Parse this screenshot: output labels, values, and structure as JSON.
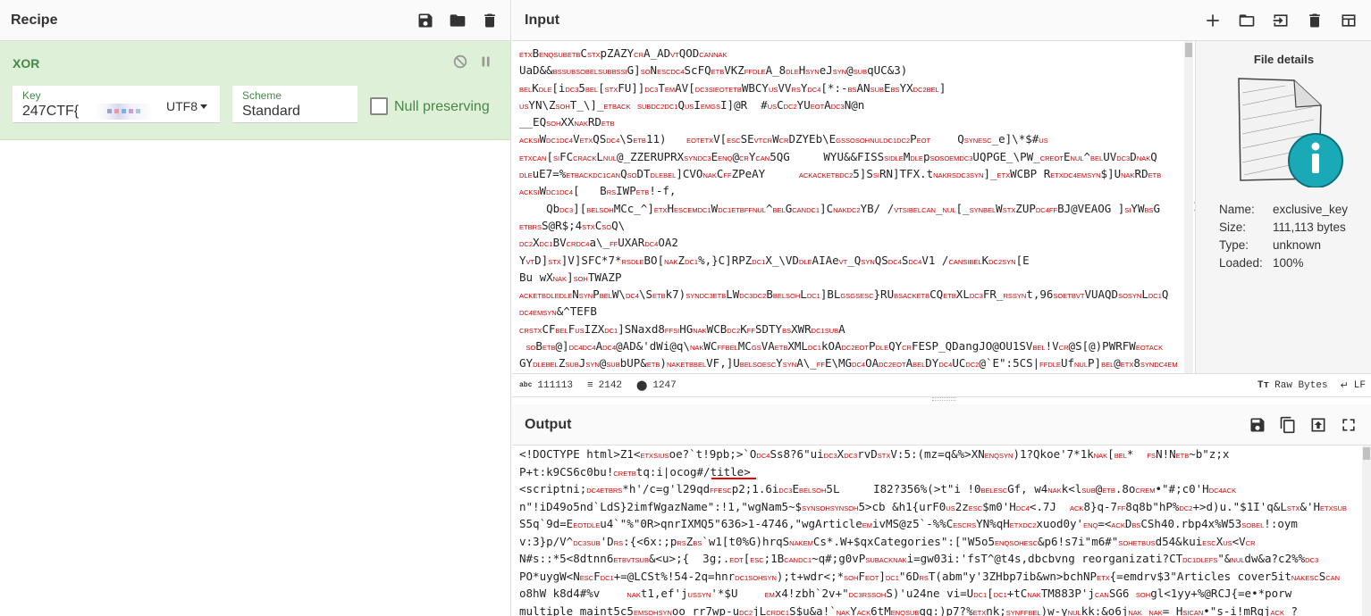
{
  "recipe": {
    "title": "Recipe",
    "operation": {
      "name": "XOR",
      "key_label": "Key",
      "key_value_prefix": "247CTF{",
      "key_encoding": "UTF8",
      "scheme_label": "Scheme",
      "scheme_value": "Standard",
      "null_preserving_label": "Null preserving"
    }
  },
  "input": {
    "title": "Input",
    "lines": [
      "ETXBENQSUBETBCSTXpZAZYCRA_ADVTQODCANNAK",
      "UaD&&BSSUBSOBELSUBBSSIG]SONESCDC4ScFQETBVKZFFDLEA_8DLEHSYNeJSYN@SUBqUC&3)",
      "BELKDLE[iDC35BEL[STXFU]]DC3TEMAV[DC3SIEOTETBWBCYUSVVRSYDC4[*:-BSANSUBEBSYXDC2BEL]",
      "USYN\\ZSOHT_\\]_ETBACK SUBDC2DC1QUSIEMGSI]@R  #USCDC2YUEOTADC3N@n",
      "__EQSOHXXNAKRDETB",
      "ACKSIWDC1DC4VETXQSDC4\\SETB11)   EOTETXV[ESCSEVTCRWCRDZYEb\\EGSSOSOHNULDC1DC2PEOT    QSYNESC_e]\\*$#US",
      "ETXCAN[SIFCCRACKLNUL@_ZZERUPRXSYNDC3EENQ@CRYCAN5QG     WYU&&FISSSIDLEMDLEpSOSOEMDC3UQPGE_\\PW_CREOTENUL^BELUVDC3DNAKQ",
      "DLEuE7=%ETBACKDC1CANQSODTDLEBEL]CVONAKCFFZPeAY     ACKACKETBDC25]SSIRN]TFX.tNAKRSDC3SYN]_ETXWCBP RETXDC4EMSYN$]UNAKRDETB",
      "ACKSIWDC1DC4[   BRSIWPETB!-f,",
      "    QbDC3][BELSOHMCc_^]ETXHESCEMDC1WDC1ETBFFNUL^BELGCANDC1]CNAKDC2YB/ /VTSIBELCAN_NUL[_SYNBELWSTXZUPDC4FFBJ@VEAOG ]SIYWBSG",
      "ETBRSS@R$;4STXCSOQ\\",
      "DC2XDC1BVCRDC4a\\_FFUXARDC4OA2",
      "YVTD]STX]V]SFC*7*RSDLEBO[NAKZDC1%,}C]RPZDC1X_\\VDDLEAIAeVT_QSYNQSDC4SDC4V1 /CANSIBELKDC2SYN[E",
      "Bu wXNAK]SOHTWAZP",
      "ACKETBDLEDLENSYNPBELW\\DC4\\SETBk7)SYNDC3ETBLWDC3DC2BBELSOHLDC1]BLGSGSESC}RUBSACKETBCQETBXLDC3FR_RSSYNt,96SOETBVTVUAQDSOSYNLDC1Q",
      "DC4EMSYN&^TEFB",
      "CRSTXCFBELFUSIZXDC1]SNaxd8FFSIHGNAKWCBDC2KFFSDTYBSXWRDC1SUBA",
      " SOBETB@]DC4DC4ADC4@AD&'dWi@q\\NAKWCFFBELMCGSVAETBXMLDC1kOADC2EOTPDLEQYCRFESP_QDangJO@OU1SVBEL!VCR@S[@)PWRFWEOTACK",
      "GYDLEBELZSUBJSYN@SUBbUP&ETB)NAKETBBELVF,]UBELSOESCYSYNA\\_FFE\\MGDC4OADC2EOTABELDYDC4UCDC2@`E\":5CS|FFDLEUfNULP]BEL@ETX8SYNDC4EM"
    ],
    "details": {
      "title": "File details",
      "name_label": "Name:",
      "name": "exclusive_key",
      "size_label": "Size:",
      "size": "111,113 bytes",
      "type_label": "Type:",
      "type": "unknown",
      "loaded_label": "Loaded:",
      "loaded": "100%"
    },
    "status": {
      "length": "111113",
      "lines": "2142",
      "position": "1247",
      "format_label": "Raw Bytes",
      "eol_label": "LF"
    }
  },
  "output": {
    "title": "Output",
    "lines": [
      "<!DOCTYPE html>Z1<ETXSIUSoe?`t!9pb;>`ODC4Ss8?6\"uiDC3XDC3rvDSTXV:5:(mz=q&%>XNENQSYN)1?Qkoe'7*1kNAK[BEL*  FSN!NETB~b\"z;x",
      "P+t:k9CS6c0bu!CRETBtq:i|ocog#/title>",
      "<scriptni;DC4ETBRS*h'/c=g'l29qdFFESCp2;1.6iDC3EBELSOH5L     I82?356%(>t\"i !0BELESCGf, w4NAKk<lSUB@ETB.8oCREM•\"#;c0'HDC4ACK",
      "n\"!iD49o5nd`LdS}2imfWgazName\":!1,\"wgNam5~$SYNSOHSYNSOH5>cb &h1{urF0US2zESC$m0'HDC4<.7J  ACK8}q-7FF8q8b\"hP%DC2+>d)u.\"$1I'q&LSTX&'HETXSUB",
      "S5q`9d=EEOTDLEu4`\"%\"0R>qnrIXMQ5\"636>1-4746,\"wgArticleEMivMS@z5`-%%CESCRSYN%qHETXDC2xuod0y'ENQ=<ACKDBSCSh40.rbp4x%W53SOBEL!:oym",
      "v:3}p/V^DC3SUB'DRS:{<6x:;pRSZBS`w1[t0%G)hrqSNAKEMCs*.W+$qxCategories\":[\"W5o5ENQSOHESC&p6!s7i\"m6#\"SOHETBUSd54&kuiESCXUS<VCR",
      "N#s::*5<8dtnn6ETBVTSUB&<u>;{  3g;.EOT[ESC;1BCANDC1~q#;g0vPSUBACKNAKi=gw03i:'fsT^@t4s,dbcbvng reorganizati?CTDC1DLEFS\"&NULdw&a?c2%%DC3",
      "PO*uygW<NESCFDC1+=@LCSt%!54-2q=hnrDC1SOHSYN);t+wdr<;*SOHFEOT]DC1\"6DRST(abm\"y'3ZHbp7ib&wn>bchNPETX{=emdrv$3\"Articles cover5itNAKESCSCAN",
      "o8hW k8d4#%v    NAKt1,ef'jUSSYN'*$U    EMx4!zbh`2v+\"DC3RSSOHS)'u24ne vi=UDC1[DC1+tCNAKTM883P'jCANSG6 SOHgl<1yy+%@RCJ{=e•*porw",
      "multiple maint5c5EMSOHSYNoo rr7wp-uDC2jLCRDC1S$u&a!`NAKYACK6tMENQSUBqq:)p7?%ETXnk;SYNFFBEL)w-yNULkk:&o6jNAK NAK= HSICAN•\"s-i!mRqjACK ?"
    ]
  },
  "colors": {
    "op_bg": "#dff0d8",
    "op_green": "#468847",
    "control_char": "#cc0000",
    "info_teal": "#1aa9b7"
  },
  "icons": {
    "recipe": [
      "save-icon",
      "folder-icon",
      "trash-icon"
    ],
    "input": [
      "add-icon",
      "folder-icon",
      "import-icon",
      "trash-icon",
      "layout-icon"
    ],
    "output": [
      "save-icon",
      "copy-icon",
      "replace-input-icon",
      "fullscreen-icon"
    ]
  }
}
